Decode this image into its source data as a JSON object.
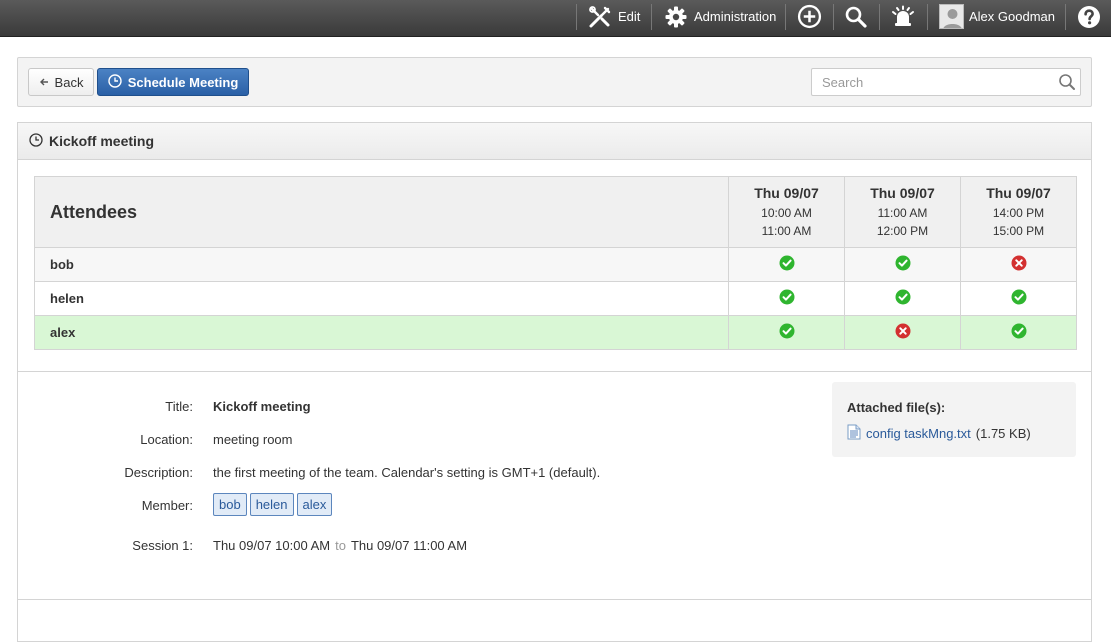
{
  "topbar": {
    "edit_label": "Edit",
    "admin_label": "Administration",
    "user_name": "Alex Goodman"
  },
  "toolbar": {
    "back_label": "Back",
    "schedule_label": "Schedule Meeting",
    "search_placeholder": "Search"
  },
  "meeting": {
    "header_title": "Kickoff meeting",
    "attendees_label": "Attendees",
    "slots": [
      {
        "date": "Thu 09/07",
        "start": "10:00 AM",
        "end": "11:00 AM"
      },
      {
        "date": "Thu 09/07",
        "start": "11:00 AM",
        "end": "12:00 PM"
      },
      {
        "date": "Thu 09/07",
        "start": "14:00 PM",
        "end": "15:00 PM"
      }
    ],
    "attendees": [
      {
        "name": "bob",
        "availability": [
          "yes",
          "yes",
          "no"
        ]
      },
      {
        "name": "helen",
        "availability": [
          "yes",
          "yes",
          "yes"
        ]
      },
      {
        "name": "alex",
        "availability": [
          "yes",
          "no",
          "yes"
        ]
      }
    ]
  },
  "details": {
    "title_label": "Title:",
    "title_value": "Kickoff meeting",
    "location_label": "Location:",
    "location_value": "meeting room",
    "description_label": "Description:",
    "description_value": "the first meeting of the team. Calendar's setting is GMT+1 (default).",
    "member_label": "Member:",
    "members": [
      "bob",
      "helen",
      "alex"
    ],
    "session_label": "Session 1:",
    "session_start": "Thu 09/07 10:00 AM",
    "session_to": "to",
    "session_end": "Thu 09/07 11:00 AM"
  },
  "attachments": {
    "heading": "Attached file(s):",
    "file_name": "config taskMng.txt",
    "file_size": "(1.75 KB)"
  },
  "colors": {
    "accent": "#2a60a6",
    "yes": "#2fb52f",
    "no": "#d33030",
    "highlight_row": "#d9f7d5"
  }
}
